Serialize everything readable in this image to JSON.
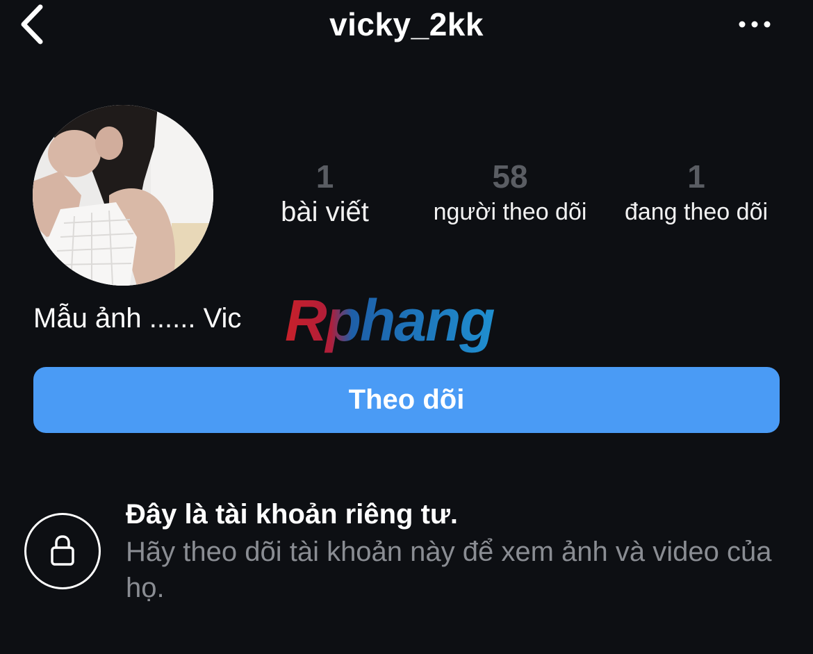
{
  "header": {
    "username": "vicky_2kk",
    "back_icon": "chevron-left-icon",
    "more_icon": "more-horizontal-icon"
  },
  "profile": {
    "avatar_icon": "profile-photo",
    "stats": {
      "posts": {
        "count": "1",
        "label": "bài viết"
      },
      "followers": {
        "count": "58",
        "label": "người theo dõi"
      },
      "following": {
        "count": "1",
        "label": "đang theo dõi"
      }
    },
    "bio": "Mẫu ảnh ...... Vic",
    "watermark": "Rphang"
  },
  "actions": {
    "follow_label": "Theo dõi"
  },
  "private_notice": {
    "icon": "lock-icon",
    "title": "Đây là tài khoản riêng tư.",
    "description": "Hãy theo dõi tài khoản này để xem ảnh và video của họ."
  },
  "colors": {
    "background": "#0d0f13",
    "accent": "#4a9bf5",
    "muted_text": "#8a8d93",
    "stat_count": "#5a5d63"
  }
}
